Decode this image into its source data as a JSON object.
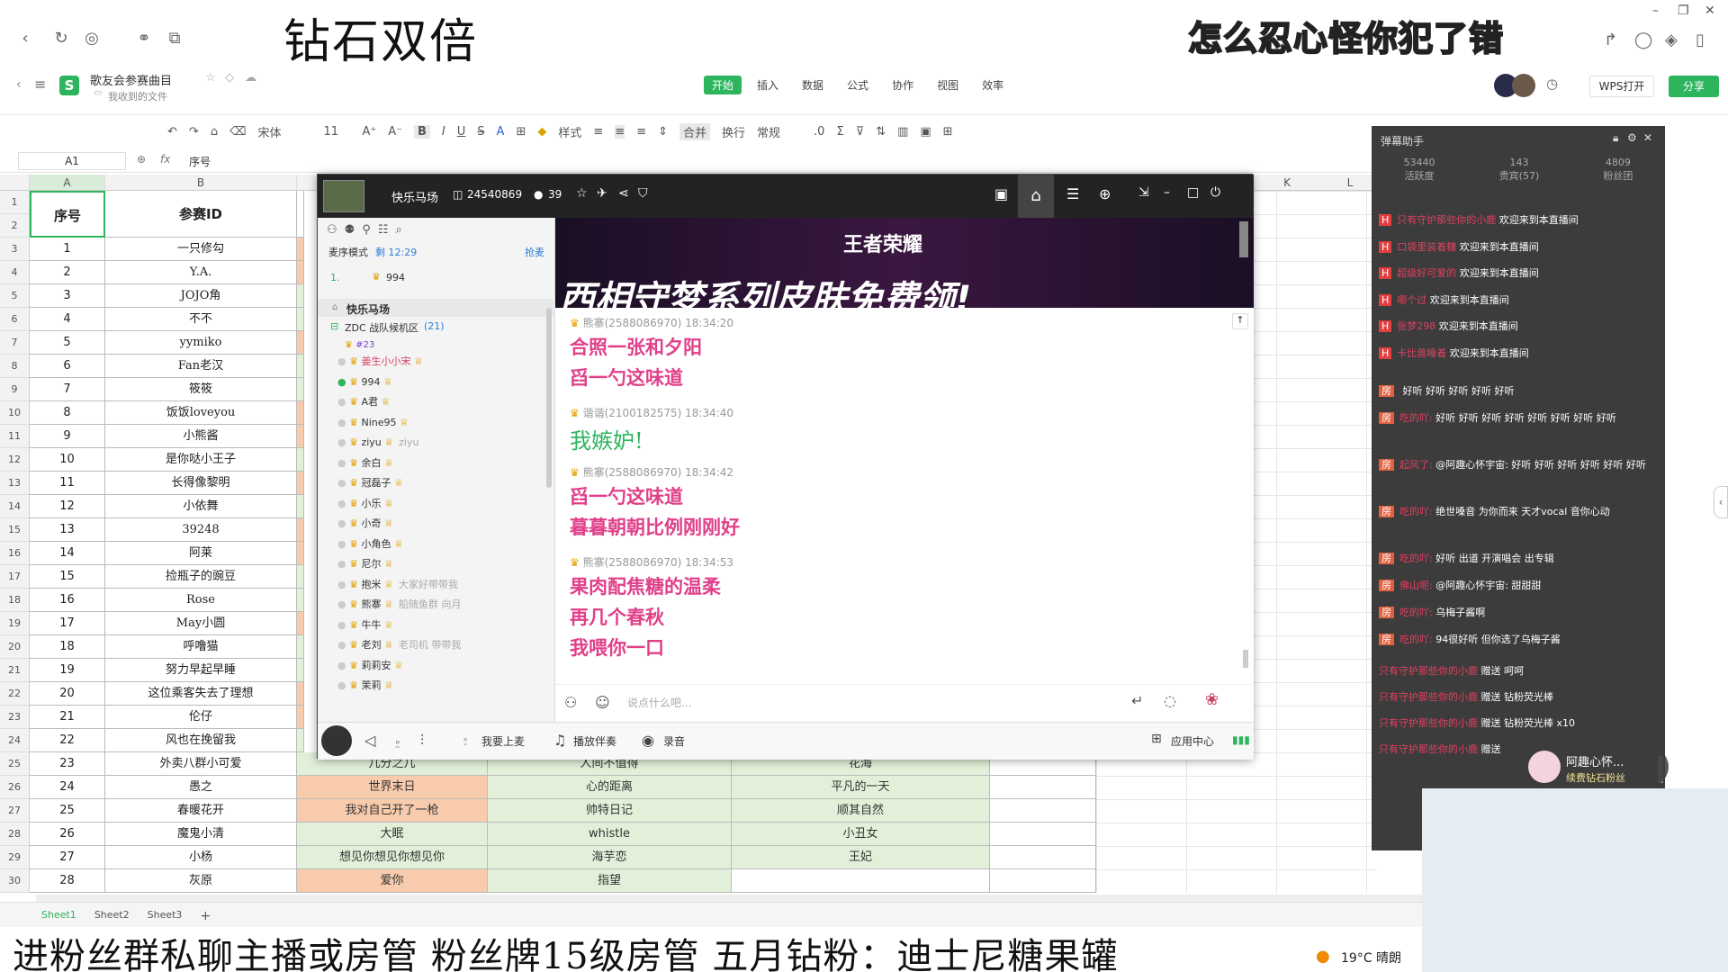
{
  "overlay": {
    "title": "钻石双倍",
    "gold_text": "怎么忍心怪你犯了错",
    "bottom_banner": "进粉丝群私聊主播或房管 粉丝牌15级房管 五月钻粉：迪士尼糖果罐"
  },
  "doc": {
    "title": "歌友会参赛曲目",
    "subtitle": "我收到的文件",
    "tabs": [
      "开始",
      "插入",
      "数据",
      "公式",
      "协作",
      "视图",
      "效率"
    ],
    "wps_button": "WPS打开",
    "share_button": "分享",
    "namebox": "A1",
    "formula": "序号"
  },
  "toolbar": {
    "font": "宋体",
    "size": "11",
    "style": "样式",
    "merge": "合并",
    "wrap": "换行",
    "format": "常规"
  },
  "sheet": {
    "col_headers": [
      "A",
      "B",
      "K",
      "L"
    ],
    "header_a": "序号",
    "header_b": "参赛ID",
    "row_numbers": [
      "1",
      "2",
      "3",
      "4",
      "5",
      "6",
      "7",
      "8",
      "9",
      "10",
      "11",
      "12",
      "13",
      "14",
      "15",
      "16",
      "17",
      "18",
      "19",
      "20",
      "21",
      "22",
      "23",
      "24",
      "25",
      "26",
      "27",
      "28",
      "29",
      "30"
    ],
    "rows": [
      {
        "n": "1",
        "id": "一只修勾"
      },
      {
        "n": "2",
        "id": "Y.A."
      },
      {
        "n": "3",
        "id": "JOJO角"
      },
      {
        "n": "4",
        "id": "不不"
      },
      {
        "n": "5",
        "id": "yymiko"
      },
      {
        "n": "6",
        "id": "Fan老汉"
      },
      {
        "n": "7",
        "id": "筱筱"
      },
      {
        "n": "8",
        "id": "饭饭loveyou"
      },
      {
        "n": "9",
        "id": "小熊酱"
      },
      {
        "n": "10",
        "id": "是你哒小王子"
      },
      {
        "n": "11",
        "id": "长得像黎明"
      },
      {
        "n": "12",
        "id": "小依舞"
      },
      {
        "n": "13",
        "id": "39248"
      },
      {
        "n": "14",
        "id": "阿莱"
      },
      {
        "n": "15",
        "id": "捡瓶子的豌豆"
      },
      {
        "n": "16",
        "id": "Rose"
      },
      {
        "n": "17",
        "id": "May小圆"
      },
      {
        "n": "18",
        "id": "呼噜猫"
      },
      {
        "n": "19",
        "id": "努力早起早睡"
      },
      {
        "n": "20",
        "id": "这位乘客失去了理想"
      },
      {
        "n": "21",
        "id": "伦仔"
      },
      {
        "n": "22",
        "id": "风也在挽留我"
      }
    ],
    "full_rows": [
      {
        "n": "23",
        "id": "外卖八群小可爱",
        "c": "几分之几",
        "d": "人间不值得",
        "e": "花海"
      },
      {
        "n": "24",
        "id": "愚之",
        "c": "世界末日",
        "d": "心的距离",
        "e": "平凡的一天"
      },
      {
        "n": "25",
        "id": "春暖花开",
        "c": "我对自己开了一枪",
        "d": "帅特日记",
        "e": "顺其自然"
      },
      {
        "n": "26",
        "id": "魔鬼小清",
        "c": "大眠",
        "d": "whistle",
        "e": "小丑女"
      },
      {
        "n": "27",
        "id": "小杨",
        "c": "想见你想见你想见你",
        "d": "海芋恋",
        "e": "王妃"
      },
      {
        "n": "28",
        "id": "灰原",
        "c": "爱你",
        "d": "指望",
        "e": ""
      }
    ],
    "tabs": [
      "Sheet1",
      "Sheet2",
      "Sheet3"
    ],
    "colors": {
      "peach": "#f8cbad",
      "green": "#e2f0d9"
    }
  },
  "live": {
    "room": "快乐马场",
    "room_id": "24540869",
    "viewers": "39",
    "mode": "麦序模式",
    "timer": "剩 12:29",
    "grab": "抢麦",
    "queue_num": "1.",
    "queue_user": "994",
    "group": "快乐马场",
    "subgroup": "ZDC 战队候机区",
    "subgroup_count": "(21)",
    "users": [
      "姜生小小宋",
      "994",
      "A君",
      "Nine95",
      "ziyu",
      "余白",
      "冠磊子",
      "小乐",
      "小奇",
      "小角色",
      "尼尔",
      "抱米",
      "熊寨",
      "牛牛",
      "老刘",
      "莉莉安",
      "茉莉"
    ],
    "user_notes": {
      "ziyu": "ziyu",
      "抱米": "大家好带带我",
      "熊寨": "船随鱼群 向月",
      "老刘": "老司机 带带我"
    },
    "game_logo": "王者荣耀",
    "banner_text": "西相守梦系列皮肤免费领!",
    "messages": [
      {
        "name": "熊寨(2588086970)",
        "time": "18:34:20",
        "lines": [
          "合照一张和夕阳",
          "舀一勺这味道"
        ],
        "color": "#e0408a"
      },
      {
        "name": "谐谐(2100182575)",
        "time": "18:34:40",
        "lines": [
          "我嫉妒!"
        ],
        "color": "#2db55d"
      },
      {
        "name": "熊寨(2588086970)",
        "time": "18:34:42",
        "lines": [
          "舀一勺这味道",
          "暮暮朝朝比例刚刚好"
        ],
        "color": "#e0408a"
      },
      {
        "name": "熊寨(2588086970)",
        "time": "18:34:53",
        "lines": [
          "果肉配焦糖的温柔",
          "再几个春秋",
          "我喂你一口"
        ],
        "color": "#e0408a"
      }
    ],
    "input_placeholder": "说点什么吧...",
    "bottom": {
      "mic": "我要上麦",
      "music": "播放伴奏",
      "record": "录音",
      "apps": "应用中心"
    }
  },
  "danmu": {
    "title": "弹幕助手",
    "stats": [
      {
        "value": "53440",
        "label": "活跃度"
      },
      {
        "value": "143",
        "label": "贵宾(57)"
      },
      {
        "value": "4809",
        "label": "粉丝团"
      }
    ],
    "welcome": [
      {
        "user": "只有守护那些你的小鹿",
        "text": "欢迎来到本直播间"
      },
      {
        "user": "口袋里装着糖",
        "text": "欢迎来到本直播间"
      },
      {
        "user": "超级好可爱的",
        "text": "欢迎来到本直播间"
      },
      {
        "user": "哪个过",
        "text": "欢迎来到本直播间"
      },
      {
        "user": "张梦298",
        "text": "欢迎来到本直播间"
      },
      {
        "user": "卡比兽睡着",
        "text": "欢迎来到本直播间"
      }
    ],
    "chat": [
      {
        "user": "",
        "text": "好听 好听 好听 好听 好听"
      },
      {
        "user": "吃的吖:",
        "text": "好听 好听 好听 好听 好听 好听 好听 好听"
      },
      {
        "user": "起风了:",
        "text": "@阿趣心怀宇宙: 好听 好听 好听 好听 好听 好听"
      },
      {
        "user": "吃的吖:",
        "text": "绝世嗓音 为你而来 天才vocal 音你心动"
      },
      {
        "user": "吃的吖:",
        "text": "好听 出道 开演唱会 出专辑"
      },
      {
        "user": "佛山呢:",
        "text": "@阿趣心怀宇宙: 甜甜甜"
      },
      {
        "user": "吃的吖:",
        "text": "乌梅子酱啊"
      },
      {
        "user": "吃的吖:",
        "text": "94很好听 但你选了乌梅子酱"
      }
    ],
    "gifts": [
      {
        "user": "只有守护那些你的小鹿",
        "text": "赠送 呵呵"
      },
      {
        "user": "只有守护那些你的小鹿",
        "text": "赠送 钻粉荧光棒"
      },
      {
        "user": "只有守护那些你的小鹿",
        "text": "赠送 钻粉荧光棒 x10"
      },
      {
        "user": "只有守护那些你的小鹿",
        "text": "赠送"
      }
    ],
    "gift_popup_user": "阿趣心怀...",
    "gift_popup_text": "续费钻石粉丝"
  },
  "taskbar": {
    "weather": "19°C 晴朗"
  }
}
